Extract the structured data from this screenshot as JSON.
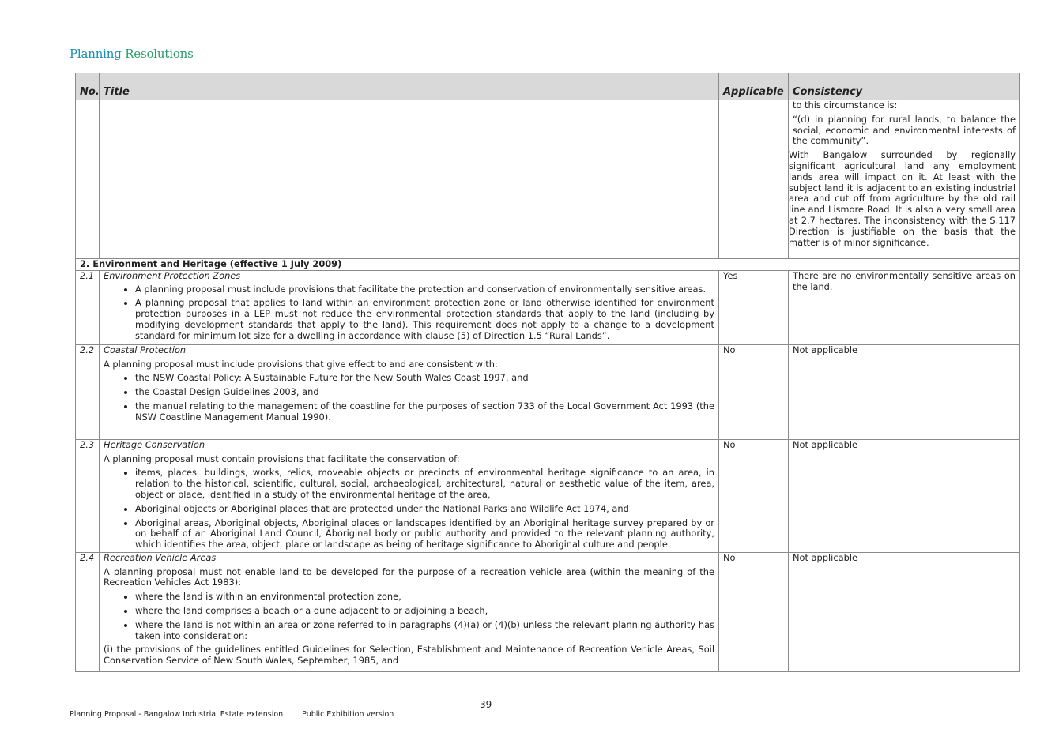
{
  "heading": {
    "word1": "Planning",
    "word2": "Resolutions"
  },
  "table": {
    "headers": {
      "no": "No.",
      "title": "Title",
      "applicable": "Applicable",
      "consistency": "Consistency"
    },
    "continuation": {
      "lines": [
        "to this circumstance is:",
        "“(d) in planning for rural lands, to balance the social, economic and environmental interests of the community”.",
        "With Bangalow surrounded by regionally significant agricultural land any employment lands area will impact on it. At least with the subject land it is adjacent to an existing industrial area and cut off from agriculture by the old rail line and Lismore Road. It is also a very small area at 2.7 hectares. The inconsistency with the S.117 Direction is justifiable on the basis that the matter is of minor significance."
      ]
    },
    "section_header": "2. Environment and Heritage (effective 1 July 2009)",
    "rows": [
      {
        "no": "2.1",
        "title": "Environment Protection Zones",
        "bullets": [
          "A planning proposal must include provisions that facilitate the protection and conservation of environmentally sensitive areas.",
          "A planning proposal that applies to land within an environment protection zone or land otherwise identified for environment protection purposes in a LEP must not reduce the environmental protection standards that apply to the land (including by modifying development standards that apply to the land). This requirement does not apply to a change to a development standard for minimum lot size for a dwelling in accordance with clause (5) of Direction 1.5 “Rural Lands”."
        ],
        "applicable": "Yes",
        "consistency": "There are no environmentally sensitive areas on the land."
      },
      {
        "no": "2.2",
        "title": "Coastal Protection",
        "intro": "A planning proposal must include provisions that give effect to and are consistent with:",
        "bullets": [
          "the NSW Coastal Policy: A Sustainable Future for the New South Wales Coast 1997, and",
          "the Coastal Design Guidelines 2003, and",
          "the manual relating to the management of the coastline for the purposes of section 733 of the Local Government Act 1993 (the NSW Coastline Management Manual 1990)."
        ],
        "applicable": "No",
        "consistency": "Not applicable"
      },
      {
        "no": "2.3",
        "title": "Heritage Conservation",
        "intro": "A planning proposal must contain provisions that facilitate the conservation of:",
        "bullets": [
          "items, places, buildings, works, relics, moveable objects or precincts of environmental heritage significance to an area, in relation to the historical, scientific, cultural, social, archaeological, architectural, natural or aesthetic value of the item, area, object or place, identified in a study of the environmental heritage of the area,",
          "Aboriginal objects or Aboriginal places that are protected under the National Parks and Wildlife Act 1974,  and",
          "Aboriginal areas, Aboriginal objects, Aboriginal places or landscapes identified by an Aboriginal heritage survey prepared by or on behalf of an Aboriginal Land Council, Aboriginal body or public authority and provided to the relevant planning authority, which identifies the area, object, place or landscape as being of heritage significance to Aboriginal culture and people."
        ],
        "applicable": "No",
        "consistency": "Not applicable"
      },
      {
        "no": "2.4",
        "title": "Recreation Vehicle Areas",
        "intro": "A planning proposal must not enable land to be developed for the purpose of a recreation vehicle area (within the meaning of the Recreation Vehicles Act 1983):",
        "bullets": [
          "where the land is within an environmental protection zone,",
          "where the land comprises a beach or a dune adjacent to or adjoining a beach,",
          "where the land is not within an area or zone referred to in paragraphs (4)(a) or (4)(b) unless the relevant planning authority has taken into consideration:"
        ],
        "outro": "(i) the provisions of the guidelines entitled Guidelines for Selection, Establishment and Maintenance of Recreation Vehicle Areas, Soil Conservation Service of New South Wales, September, 1985, and",
        "applicable": "No",
        "consistency": "Not applicable"
      }
    ]
  },
  "page_number": "39",
  "footer": {
    "left": "Planning Proposal - Bangalow Industrial Estate extension",
    "right": "Public Exhibition version"
  }
}
